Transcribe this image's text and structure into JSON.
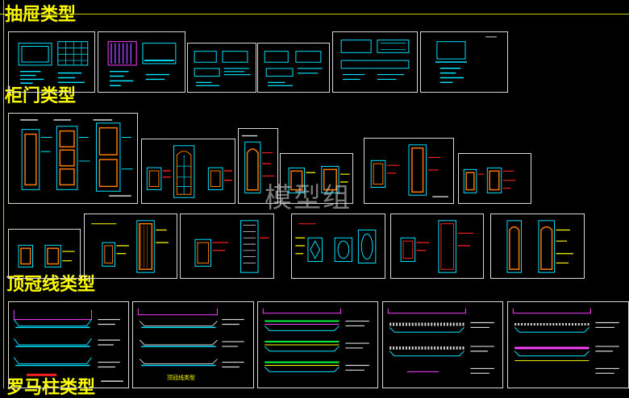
{
  "sections": {
    "drawer": "抽屉类型",
    "cabinet_door": "柜门类型",
    "crown_molding": "顶冠线类型",
    "roman_column": "罗马柱类型"
  },
  "captions": {
    "crown_sheet_2": "顶冠线类型"
  },
  "watermark": "模型组",
  "colors": {
    "background": "#000000",
    "title": "#ffff00",
    "frame": "#d8d8d8",
    "cyan": "#00e5ff",
    "orange": "#ff7a00",
    "red": "#ff2020",
    "yellow": "#ffff00",
    "magenta": "#ff40ff",
    "green": "#00ff40"
  }
}
